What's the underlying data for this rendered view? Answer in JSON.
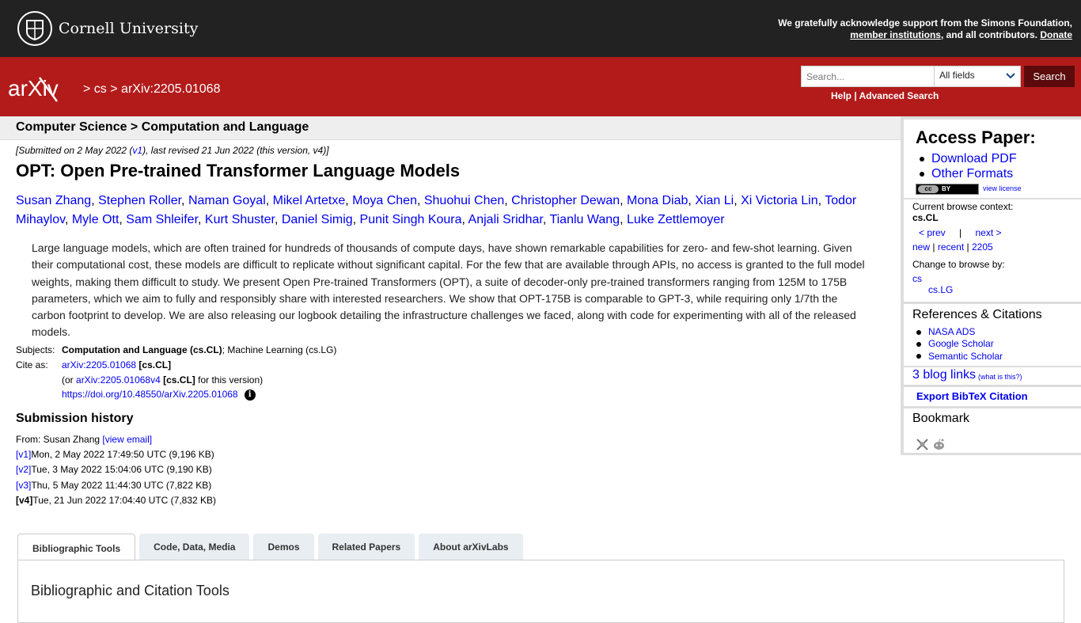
{
  "header": {
    "university": "Cornell University",
    "support_text": "We gratefully acknowledge support from the Simons Foundation,",
    "member_link": "member institutions",
    "support_tail": ", and all contributors.",
    "donate": "Donate"
  },
  "nav": {
    "logo": "arXiv",
    "crumb_sep1": ">",
    "crumb_cs": "cs",
    "crumb_sep2": ">",
    "crumb_id": "arXiv:2205.01068",
    "search_placeholder": "Search...",
    "field_select": "All fields",
    "search_button": "Search",
    "help": "Help",
    "help_sep": "|",
    "advanced": "Advanced Search"
  },
  "subheader": "Computer Science > Computation and Language",
  "paper": {
    "submitted_pre": "[Submitted on 2 May 2022 (",
    "submitted_v1": "v1",
    "submitted_post": "), last revised 21 Jun 2022 (this version, v4)]",
    "title": "OPT: Open Pre-trained Transformer Language Models",
    "authors": [
      "Susan Zhang",
      "Stephen Roller",
      "Naman Goyal",
      "Mikel Artetxe",
      "Moya Chen",
      "Shuohui Chen",
      "Christopher Dewan",
      "Mona Diab",
      "Xian Li",
      "Xi Victoria Lin",
      "Todor Mihaylov",
      "Myle Ott",
      "Sam Shleifer",
      "Kurt Shuster",
      "Daniel Simig",
      "Punit Singh Koura",
      "Anjali Sridhar",
      "Tianlu Wang",
      "Luke Zettlemoyer"
    ],
    "abstract": "Large language models, which are often trained for hundreds of thousands of compute days, have shown remarkable capabilities for zero- and few-shot learning. Given their computational cost, these models are difficult to replicate without significant capital. For the few that are available through APIs, no access is granted to the full model weights, making them difficult to study. We present Open Pre-trained Transformers (OPT), a suite of decoder-only pre-trained transformers ranging from 125M to 175B parameters, which we aim to fully and responsibly share with interested researchers. We show that OPT-175B is comparable to GPT-3, while requiring only 1/7th the carbon footprint to develop. We are also releasing our logbook detailing the infrastructure challenges we faced, along with code for experimenting with all of the released models."
  },
  "meta": {
    "subjects_label": "Subjects:",
    "subjects_primary": "Computation and Language (cs.CL)",
    "subjects_rest": "; Machine Learning (cs.LG)",
    "cite_label": "Cite as:",
    "cite_id": "arXiv:2205.01068",
    "cite_tag": "[cs.CL]",
    "or_pre": "(or",
    "or_id": "arXiv:2205.01068v4",
    "or_tag": "[cs.CL]",
    "or_post": "for this version)",
    "doi": "https://doi.org/10.48550/arXiv.2205.01068",
    "info": "i"
  },
  "history": {
    "title": "Submission history",
    "from_pre": "From: Susan Zhang",
    "view_email": "[view email]",
    "versions": [
      {
        "label": "[v1]",
        "text": " Mon, 2 May 2022 17:49:50 UTC (9,196 KB)"
      },
      {
        "label": "[v2]",
        "text": " Tue, 3 May 2022 15:04:06 UTC (9,190 KB)"
      },
      {
        "label": "[v3]",
        "text": " Thu, 5 May 2022 11:44:30 UTC (7,822 KB)"
      },
      {
        "label": "[v4]",
        "text": " Tue, 21 Jun 2022 17:04:40 UTC (7,832 KB)"
      }
    ]
  },
  "tabs": [
    "Bibliographic Tools",
    "Code, Data, Media",
    "Demos",
    "Related Papers",
    "About arXivLabs"
  ],
  "panel_title": "Bibliographic and Citation Tools",
  "sidebar": {
    "access_title": "Access Paper:",
    "download_pdf": "Download PDF",
    "other_formats": "Other Formats",
    "cc": "cc",
    "by": "BY",
    "view_license": "view license",
    "context_label": "Current browse context:",
    "context_value": "cs.CL",
    "prev": "< prev",
    "sep": "|",
    "next": "next >",
    "new": "new",
    "recent": "recent",
    "yymm": "2205",
    "change_label": "Change to browse by:",
    "cs": "cs",
    "cslg": "cs.LG",
    "refs_title": "References & Citations",
    "nasa": "NASA ADS",
    "google": "Google Scholar",
    "semantic": "Semantic Scholar",
    "blog": "3 blog links",
    "whatis": "(what is this?)",
    "bibtex": "Export BibTeX Citation",
    "bookmark": "Bookmark"
  },
  "colors": {
    "header_black": "#222222",
    "arxiv_red": "#b31b1b",
    "link": "#0000ee"
  }
}
